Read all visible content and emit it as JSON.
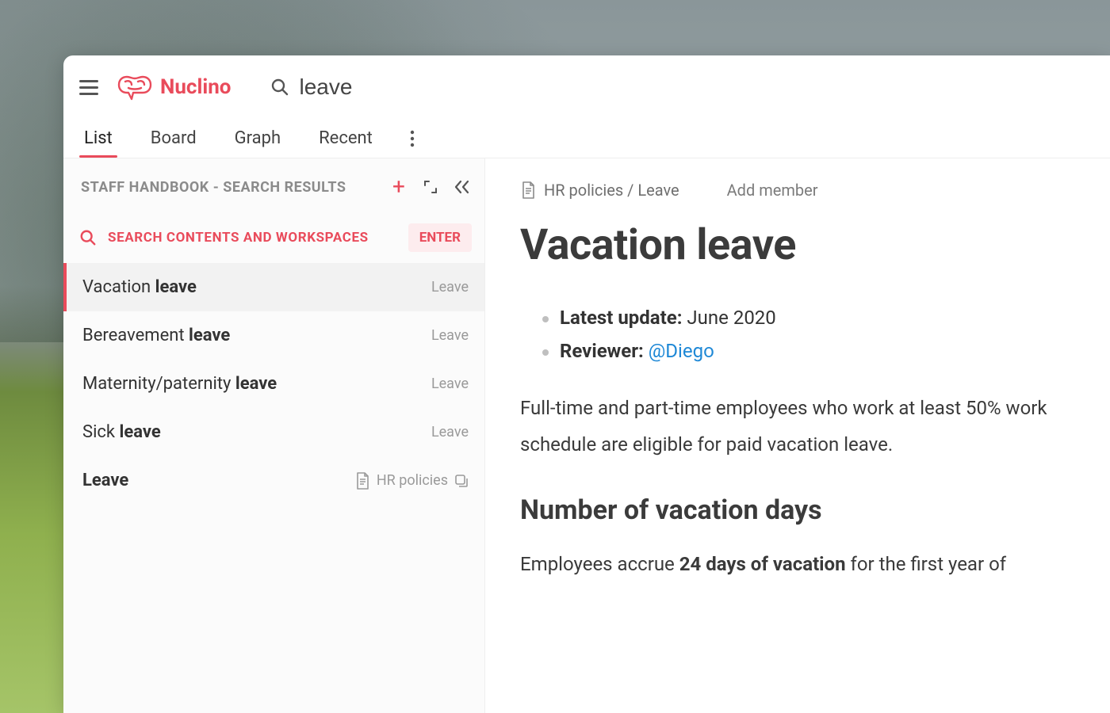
{
  "brand": {
    "name": "Nuclino"
  },
  "search": {
    "value": "leave"
  },
  "tabs": {
    "items": [
      {
        "label": "List",
        "active": true
      },
      {
        "label": "Board",
        "active": false
      },
      {
        "label": "Graph",
        "active": false
      },
      {
        "label": "Recent",
        "active": false
      }
    ]
  },
  "sidebar": {
    "title": "STAFF HANDBOOK - SEARCH RESULTS",
    "search_all_label": "SEARCH CONTENTS AND WORKSPACES",
    "enter_label": "ENTER",
    "results": [
      {
        "title_prefix": "Vacation ",
        "title_match": "leave",
        "category": "Leave",
        "selected": true
      },
      {
        "title_prefix": "Bereavement ",
        "title_match": "leave",
        "category": "Leave",
        "selected": false
      },
      {
        "title_prefix": "Maternity/paternity ",
        "title_match": "leave",
        "category": "Leave",
        "selected": false
      },
      {
        "title_prefix": "Sick ",
        "title_match": "leave",
        "category": "Leave",
        "selected": false
      },
      {
        "title_prefix": "Leave",
        "title_match": "",
        "category": "HR policies",
        "selected": false,
        "is_collection": true
      }
    ]
  },
  "content": {
    "breadcrumb": "HR policies / Leave",
    "add_member_label": "Add member",
    "title": "Vacation leave",
    "meta": {
      "update_label": "Latest update:",
      "update_value": "June 2020",
      "reviewer_label": "Reviewer:",
      "reviewer_mention": "@Diego"
    },
    "paragraph1": "Full-time and part-time employees who work at least 50% work schedule are eligible for paid vacation leave.",
    "subheading1": "Number of vacation days",
    "paragraph2_prefix": "Employees accrue ",
    "paragraph2_bold": "24 days of vacation",
    "paragraph2_suffix": " for the first year of"
  }
}
